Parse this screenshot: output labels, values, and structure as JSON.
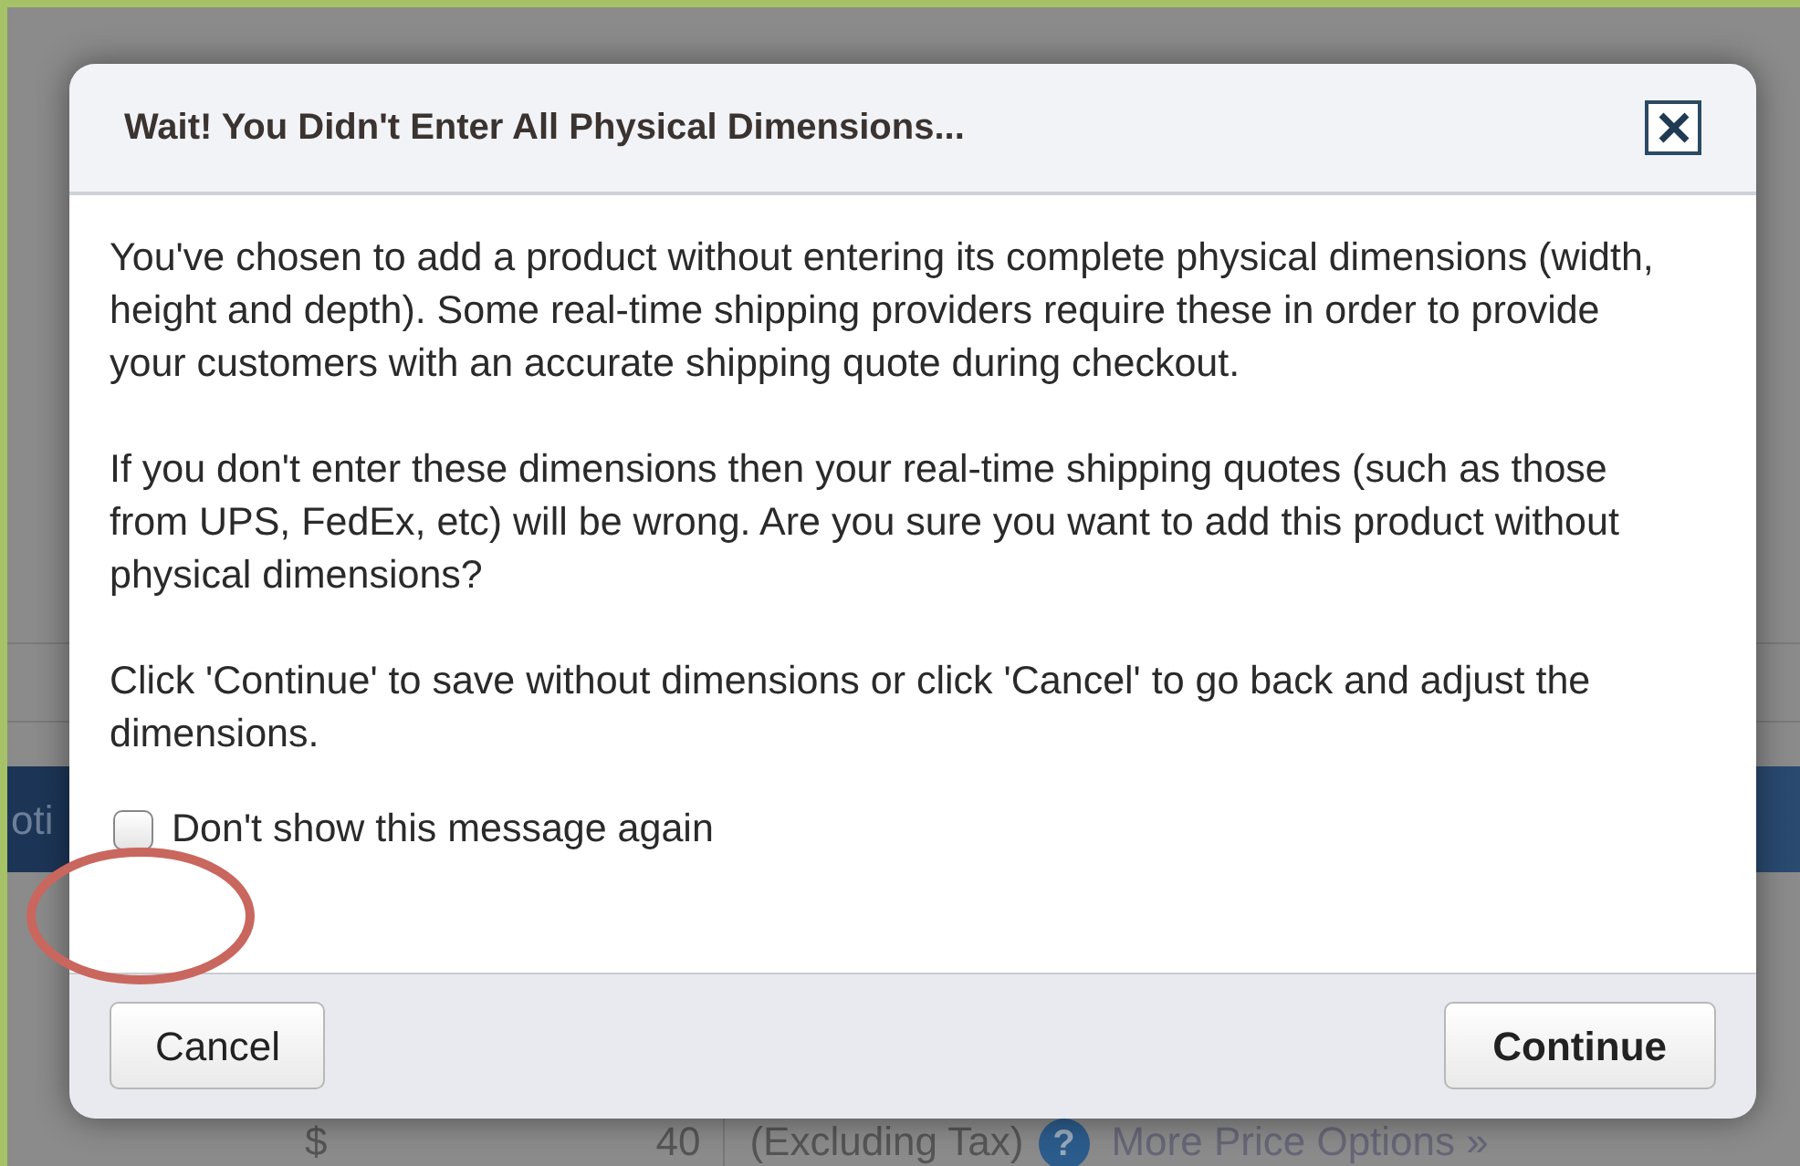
{
  "background": {
    "side_tab": "oti",
    "price_row": {
      "currency": "$",
      "amount": "40",
      "note": "(Excluding Tax)",
      "help": "?",
      "link": "More Price Options »"
    }
  },
  "dialog": {
    "title": "Wait! You Didn't Enter All Physical Dimensions...",
    "paragraphs": [
      "You've chosen to add a product without entering its complete physical dimensions (width, height and depth). Some real-time shipping providers require these in order to provide your customers with an accurate shipping quote during checkout.",
      "If you don't enter these dimensions then your real-time shipping quotes (such as those from UPS, FedEx, etc) will be wrong. Are you sure you want to add this product without physical dimensions?",
      "Click 'Continue' to save without dimensions or click 'Cancel' to go back and adjust the dimensions."
    ],
    "checkbox": {
      "label": "Don't show this message again",
      "checked": false
    },
    "buttons": [
      {
        "label": "Cancel",
        "primary": false
      },
      {
        "label": "Continue",
        "primary": true
      }
    ]
  },
  "annotation": {
    "kind": "ellipse"
  }
}
